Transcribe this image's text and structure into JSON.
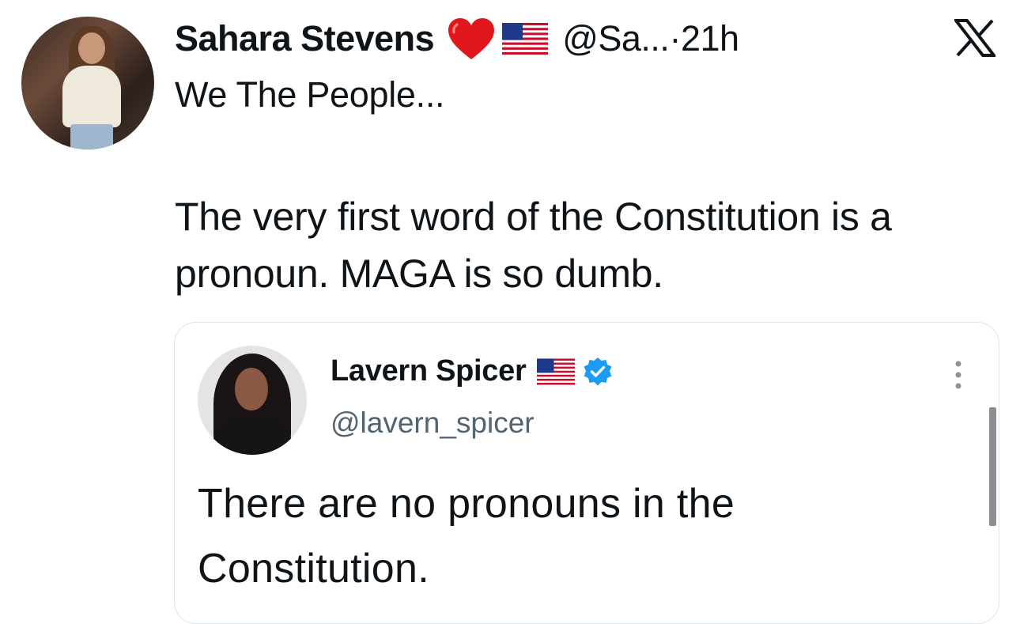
{
  "tweet": {
    "author_name": "Sahara Stevens",
    "handle": "@Sa...",
    "separator": "·",
    "time": "21h",
    "line1": "We The People...",
    "body": "The very first word of the Constitution is a pronoun.  MAGA is so dumb.",
    "badges": [
      "red-heart-emoji",
      "us-flag-emoji"
    ]
  },
  "quoted_tweet": {
    "author_name": "Lavern Spicer",
    "handle": "@lavern_spicer",
    "text": "There are no pronouns in the Constitution.",
    "badges": [
      "us-flag-emoji",
      "verified-badge"
    ]
  },
  "colors": {
    "text": "#0f1419",
    "secondary_text": "#536471",
    "verified_blue": "#1d9bf0",
    "heart_red": "#e0171f",
    "border": "#dfe3e6"
  },
  "icons": [
    "x-logo-icon",
    "more-vertical-icon",
    "verified-badge-icon"
  ]
}
